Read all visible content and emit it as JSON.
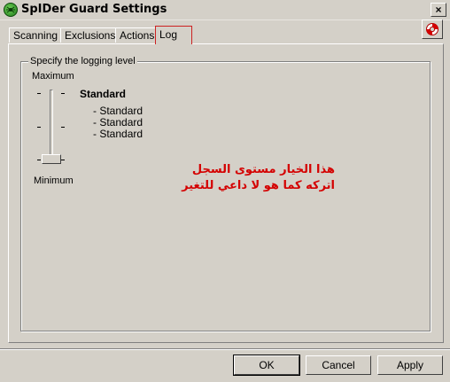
{
  "window": {
    "title": "SpIDer Guard Settings",
    "close_label": "×"
  },
  "tabs": [
    {
      "label": "Scanning"
    },
    {
      "label": "Exclusions"
    },
    {
      "label": "Actions"
    },
    {
      "label": "Log",
      "selected": true
    }
  ],
  "log": {
    "group_label": "Specify the logging level",
    "max_label": "Maximum",
    "min_label": "Minimum",
    "slider_ticks": [
      "-",
      "-",
      "-",
      "-",
      "-",
      "-",
      "-"
    ],
    "level_title": "Standard",
    "level_items": [
      "- Standard",
      "- Standard",
      "- Standard"
    ]
  },
  "annotation": {
    "line1": "هذا الخيار مستوى السجل",
    "line2": "اتركه كما هو لا داعي للتغير"
  },
  "buttons": {
    "ok": "OK",
    "cancel": "Cancel",
    "apply": "Apply"
  },
  "colors": {
    "face": "#d4d0c8",
    "annotation": "#d40000",
    "active_tab_border": "#cc2222"
  }
}
